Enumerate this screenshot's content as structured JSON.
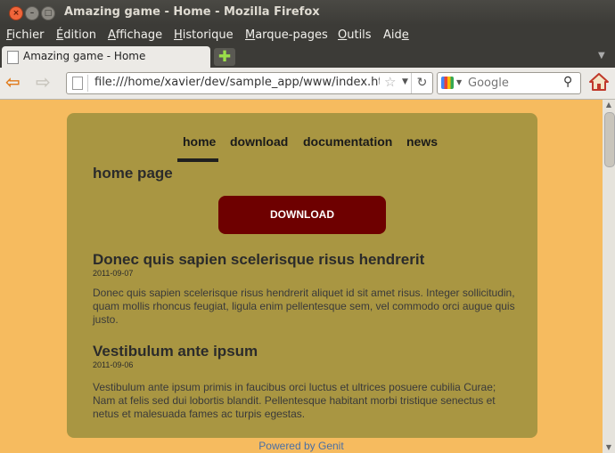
{
  "window": {
    "title": "Amazing game - Home - Mozilla Firefox"
  },
  "menubar": [
    {
      "pre": "",
      "ul": "F",
      "post": "ichier"
    },
    {
      "pre": "",
      "ul": "É",
      "post": "dition"
    },
    {
      "pre": "",
      "ul": "A",
      "post": "ffichage"
    },
    {
      "pre": "",
      "ul": "H",
      "post": "istorique"
    },
    {
      "pre": "",
      "ul": "M",
      "post": "arque-pages"
    },
    {
      "pre": "",
      "ul": "O",
      "post": "utils"
    },
    {
      "pre": "Aid",
      "ul": "e",
      "post": ""
    }
  ],
  "tab": {
    "label": "Amazing game - Home"
  },
  "address": {
    "url": "file:///home/xavier/dev/sample_app/www/index.ht"
  },
  "search": {
    "placeholder": "Google"
  },
  "colors": {
    "page_bg": "#f6bb5f",
    "card_bg": "#a99642",
    "download_bg": "#6e0000",
    "link": "#4a6fa5"
  },
  "page": {
    "nav": [
      "home",
      "download",
      "documentation",
      "news"
    ],
    "active_nav": "home",
    "heading": "home page",
    "download_label": "DOWNLOAD",
    "posts": [
      {
        "title": "Donec quis sapien scelerisque risus hendrerit",
        "date": "2011-09-07",
        "body": "Donec quis sapien scelerisque risus hendrerit aliquet id sit amet risus. Integer sollicitudin, quam mollis rhoncus feugiat, ligula enim pellentesque sem, vel commodo orci augue quis justo."
      },
      {
        "title": "Vestibulum ante ipsum",
        "date": "2011-09-06",
        "body": "Vestibulum ante ipsum primis in faucibus orci luctus et ultrices posuere cubilia Curae; Nam at felis sed dui lobortis blandit. Pellentesque habitant morbi tristique senectus et netus et malesuada fames ac turpis egestas."
      }
    ],
    "footer": "Powered by Genit"
  }
}
